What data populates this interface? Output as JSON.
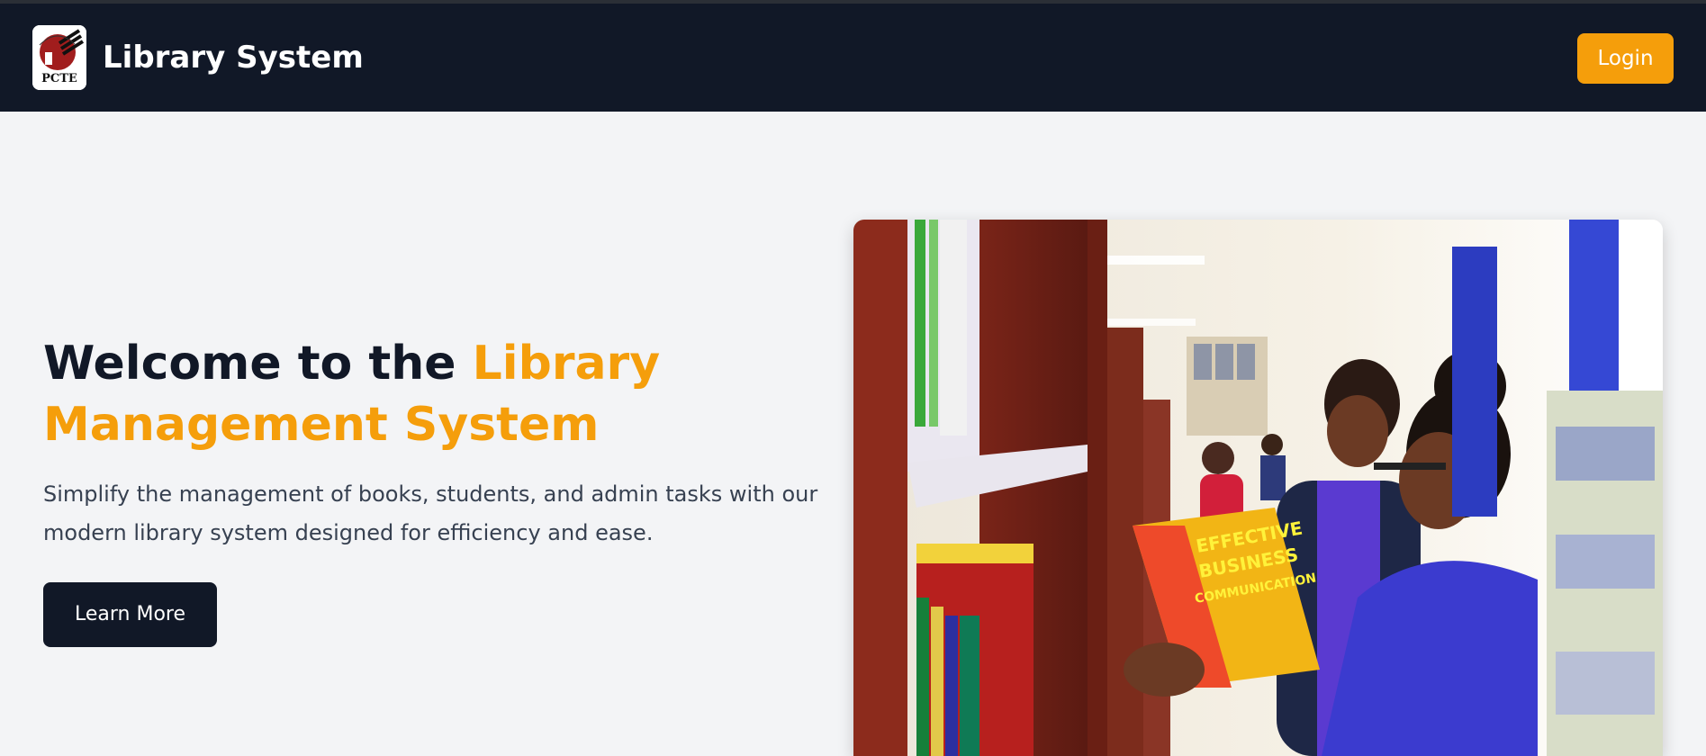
{
  "navbar": {
    "logo": {
      "text": "PCTE",
      "icon": "pcte-logo-icon"
    },
    "brand": "Library System",
    "login_label": "Login"
  },
  "hero": {
    "title_part1": "Welcome to the ",
    "title_accent": "Library Management System",
    "description": "Simplify the management of books, students, and admin tasks with our modern library system designed for efficiency and ease.",
    "learn_more_label": "Learn More",
    "image": {
      "subject": "students reading books in library",
      "book_title": "EFFECTIVE BUSINESS COMMUNICATION"
    }
  },
  "colors": {
    "nav_bg": "#111827",
    "page_bg": "#f3f4f6",
    "accent": "#f59e0b",
    "text_dark": "#111827",
    "text_body": "#374151"
  }
}
